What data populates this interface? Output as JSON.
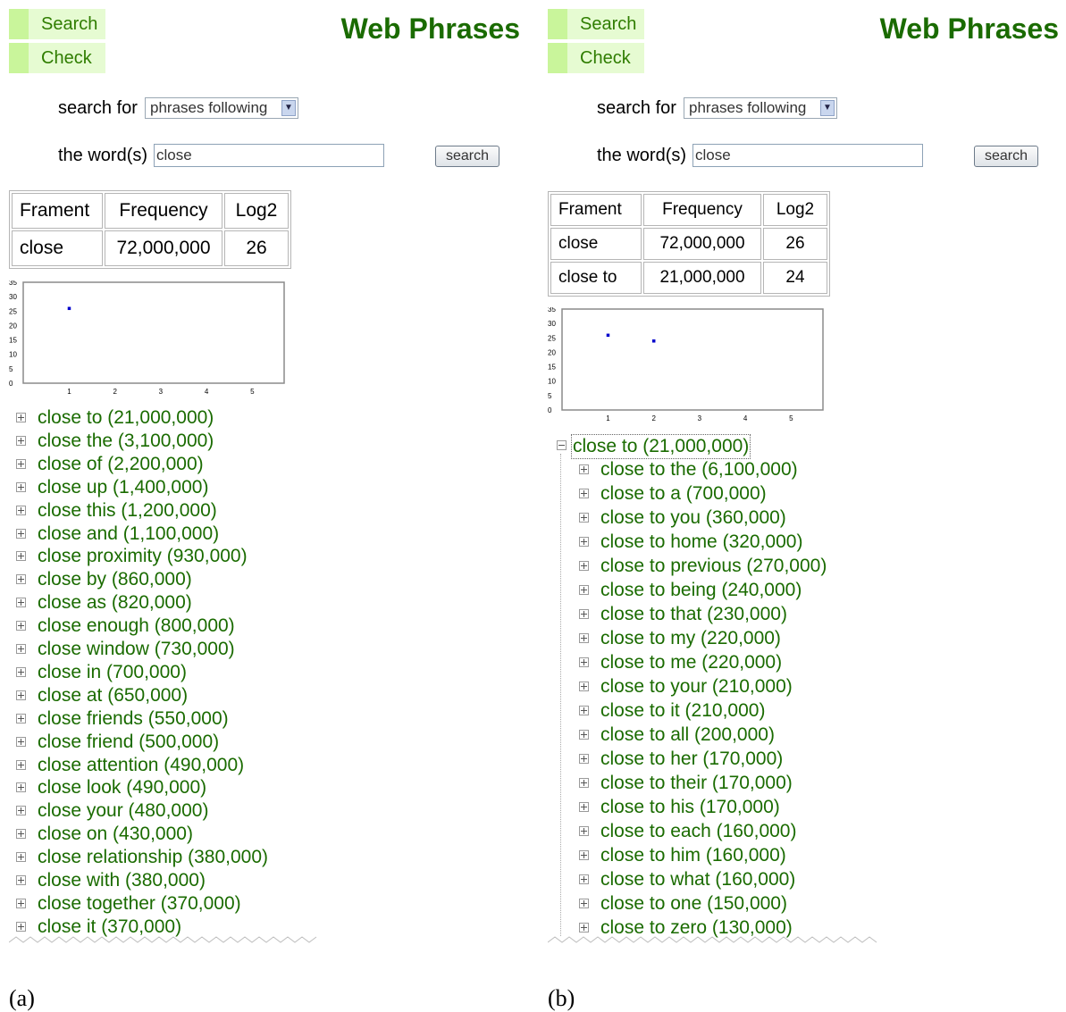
{
  "captions": {
    "a": "(a)",
    "b": "(b)"
  },
  "colors": {
    "link_green": "#1a6b00",
    "nav_bg": "#e6fbd2",
    "nav_accent": "#c9f59b",
    "point_blue": "#0000cc"
  },
  "panel_a": {
    "nav": {
      "search": "Search",
      "check": "Check"
    },
    "title": "Web Phrases",
    "search_for_label": "search for",
    "mode_value": "phrases following",
    "words_label": "the word(s)",
    "words_value": "close",
    "search_button": "search",
    "table": {
      "headers": [
        "Frament",
        "Frequency",
        "Log2"
      ],
      "rows": [
        [
          "close",
          "72,000,000",
          "26"
        ]
      ]
    },
    "list": [
      "close to (21,000,000)",
      "close the (3,100,000)",
      "close of (2,200,000)",
      "close up (1,400,000)",
      "close this (1,200,000)",
      "close and (1,100,000)",
      "close proximity (930,000)",
      "close by (860,000)",
      "close as (820,000)",
      "close enough (800,000)",
      "close window (730,000)",
      "close in (700,000)",
      "close at (650,000)",
      "close friends (550,000)",
      "close friend (500,000)",
      "close attention (490,000)",
      "close look (490,000)",
      "close your (480,000)",
      "close on (430,000)",
      "close relationship (380,000)",
      "close with (380,000)",
      "close together (370,000)",
      "close it (370,000)"
    ]
  },
  "panel_b": {
    "nav": {
      "search": "Search",
      "check": "Check"
    },
    "title": "Web Phrases",
    "search_for_label": "search for",
    "mode_value": "phrases following",
    "words_label": "the word(s)",
    "words_value": "close",
    "search_button": "search",
    "table": {
      "headers": [
        "Frament",
        "Frequency",
        "Log2"
      ],
      "rows": [
        [
          "close",
          "72,000,000",
          "26"
        ],
        [
          "close to",
          "21,000,000",
          "24"
        ]
      ]
    },
    "expanded": "close to (21,000,000)",
    "list": [
      "close to the (6,100,000)",
      "close to a (700,000)",
      "close to you (360,000)",
      "close to home (320,000)",
      "close to previous (270,000)",
      "close to being (240,000)",
      "close to that (230,000)",
      "close to my (220,000)",
      "close to me (220,000)",
      "close to your (210,000)",
      "close to it (210,000)",
      "close to all (200,000)",
      "close to her (170,000)",
      "close to their (170,000)",
      "close to his (170,000)",
      "close to each (160,000)",
      "close to him (160,000)",
      "close to what (160,000)",
      "close to one (150,000)",
      "close to zero (130,000)"
    ]
  },
  "chart_data": [
    {
      "type": "scatter",
      "x": [
        1
      ],
      "y": [
        26
      ],
      "xticks": [
        1,
        2,
        3,
        4,
        5
      ],
      "yticks": [
        0,
        5,
        10,
        15,
        20,
        25,
        30,
        35
      ],
      "xlim": [
        0,
        5.7
      ],
      "ylim": [
        0,
        35
      ],
      "title": "",
      "xlabel": "",
      "ylabel": "",
      "grid": false
    },
    {
      "type": "scatter",
      "x": [
        1,
        2
      ],
      "y": [
        26,
        24
      ],
      "xticks": [
        1,
        2,
        3,
        4,
        5
      ],
      "yticks": [
        0,
        5,
        10,
        15,
        20,
        25,
        30,
        35
      ],
      "xlim": [
        0,
        5.7
      ],
      "ylim": [
        0,
        35
      ],
      "title": "",
      "xlabel": "",
      "ylabel": "",
      "grid": false
    }
  ]
}
